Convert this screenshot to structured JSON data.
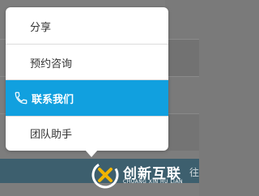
{
  "menu": {
    "items": [
      {
        "label": "分享",
        "active": false
      },
      {
        "label": "预约咨询",
        "active": false
      },
      {
        "label": "联系我们",
        "active": true,
        "icon": "phone-icon"
      },
      {
        "label": "团队助手",
        "active": false
      }
    ]
  },
  "background": {
    "bar_text": "往"
  },
  "logo": {
    "cn": "创新互联",
    "en": "CHUANG XIN HU LIAN"
  },
  "colors": {
    "active_bg": "#11a0df",
    "popup_bg": "#ffffff",
    "overlay": "#7d7d7d"
  }
}
